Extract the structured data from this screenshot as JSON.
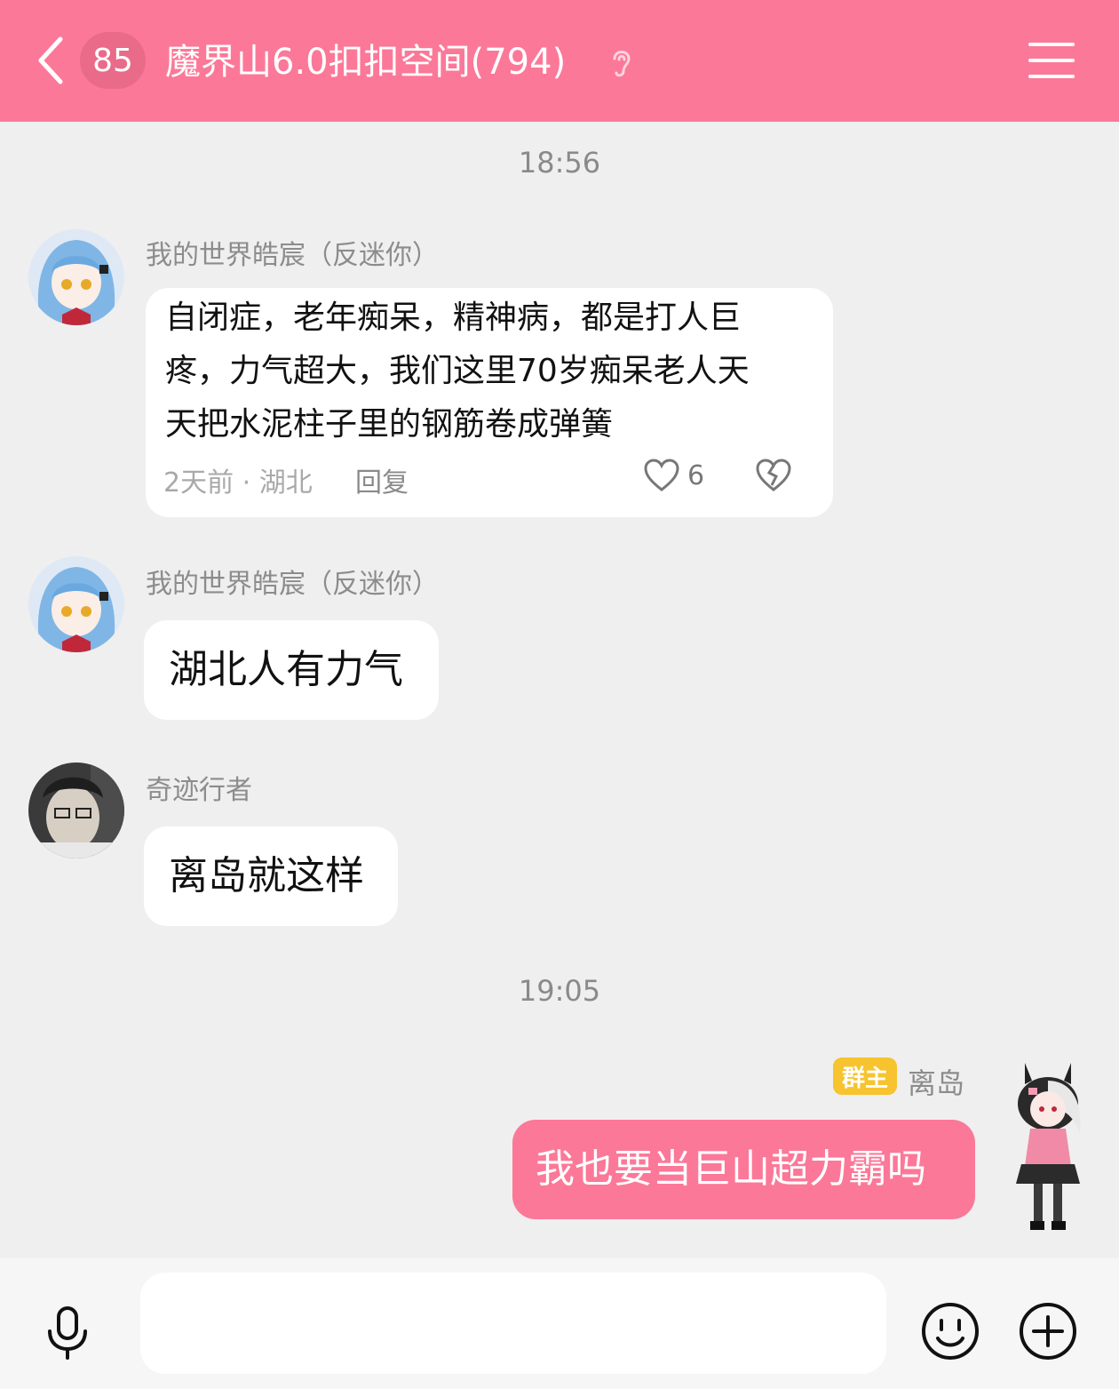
{
  "header": {
    "unread_count": "85",
    "title": "魔界山6.0扣扣空间(794)",
    "back_icon": "chevron-left-icon",
    "ear_icon": "ear-icon",
    "menu_icon": "hamburger-menu-icon",
    "background_color": "#fc7898"
  },
  "timestamps": [
    "18:56",
    "19:05"
  ],
  "messages": [
    {
      "sender": "我的世界皓宸（反迷你）",
      "lines": [
        "自闭症，老年痴呆，精神病，都是打人巨",
        "疼，力气超大，我们这里70岁痴呆老人天",
        "天把水泥柱子里的钢筋卷成弹簧"
      ],
      "meta_time_location": "2天前 · 湖北",
      "reply_label": "回复",
      "like_count": "6"
    },
    {
      "sender": "我的世界皓宸（反迷你）",
      "text": "湖北人有力气"
    },
    {
      "sender": "奇迹行者",
      "text": "离岛就这样"
    },
    {
      "sender": "离岛",
      "role_badge": "群主",
      "text": "我也要当巨山超力霸吗",
      "outgoing": true,
      "bubble_color": "#fc7898",
      "badge_color": "#f7c32e"
    }
  ],
  "input": {
    "placeholder": "",
    "voice_icon": "microphone-icon",
    "emoji_icon": "smiley-icon",
    "plus_icon": "plus-circle-icon"
  }
}
